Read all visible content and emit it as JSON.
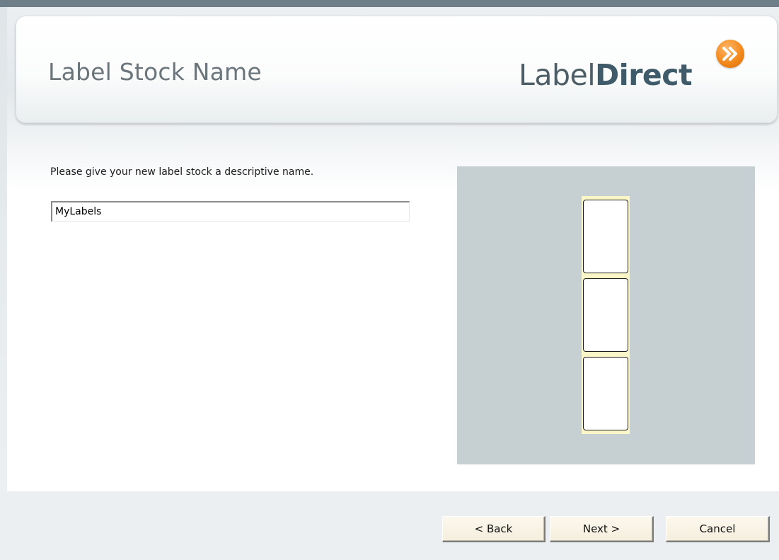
{
  "header": {
    "title": "Label Stock Name",
    "logo": {
      "text_regular": "Label",
      "text_bold": "Direct",
      "badge_icon": "double-chevron-right-icon",
      "badge_color": "#f38a1c"
    }
  },
  "form": {
    "instruction": "Please give your new label stock a descriptive name.",
    "name_value": "MyLabels"
  },
  "preview": {
    "label_count": 3,
    "background_color": "#c6d0d3"
  },
  "buttons": {
    "back": "< Back",
    "next": "Next >",
    "cancel": "Cancel"
  }
}
